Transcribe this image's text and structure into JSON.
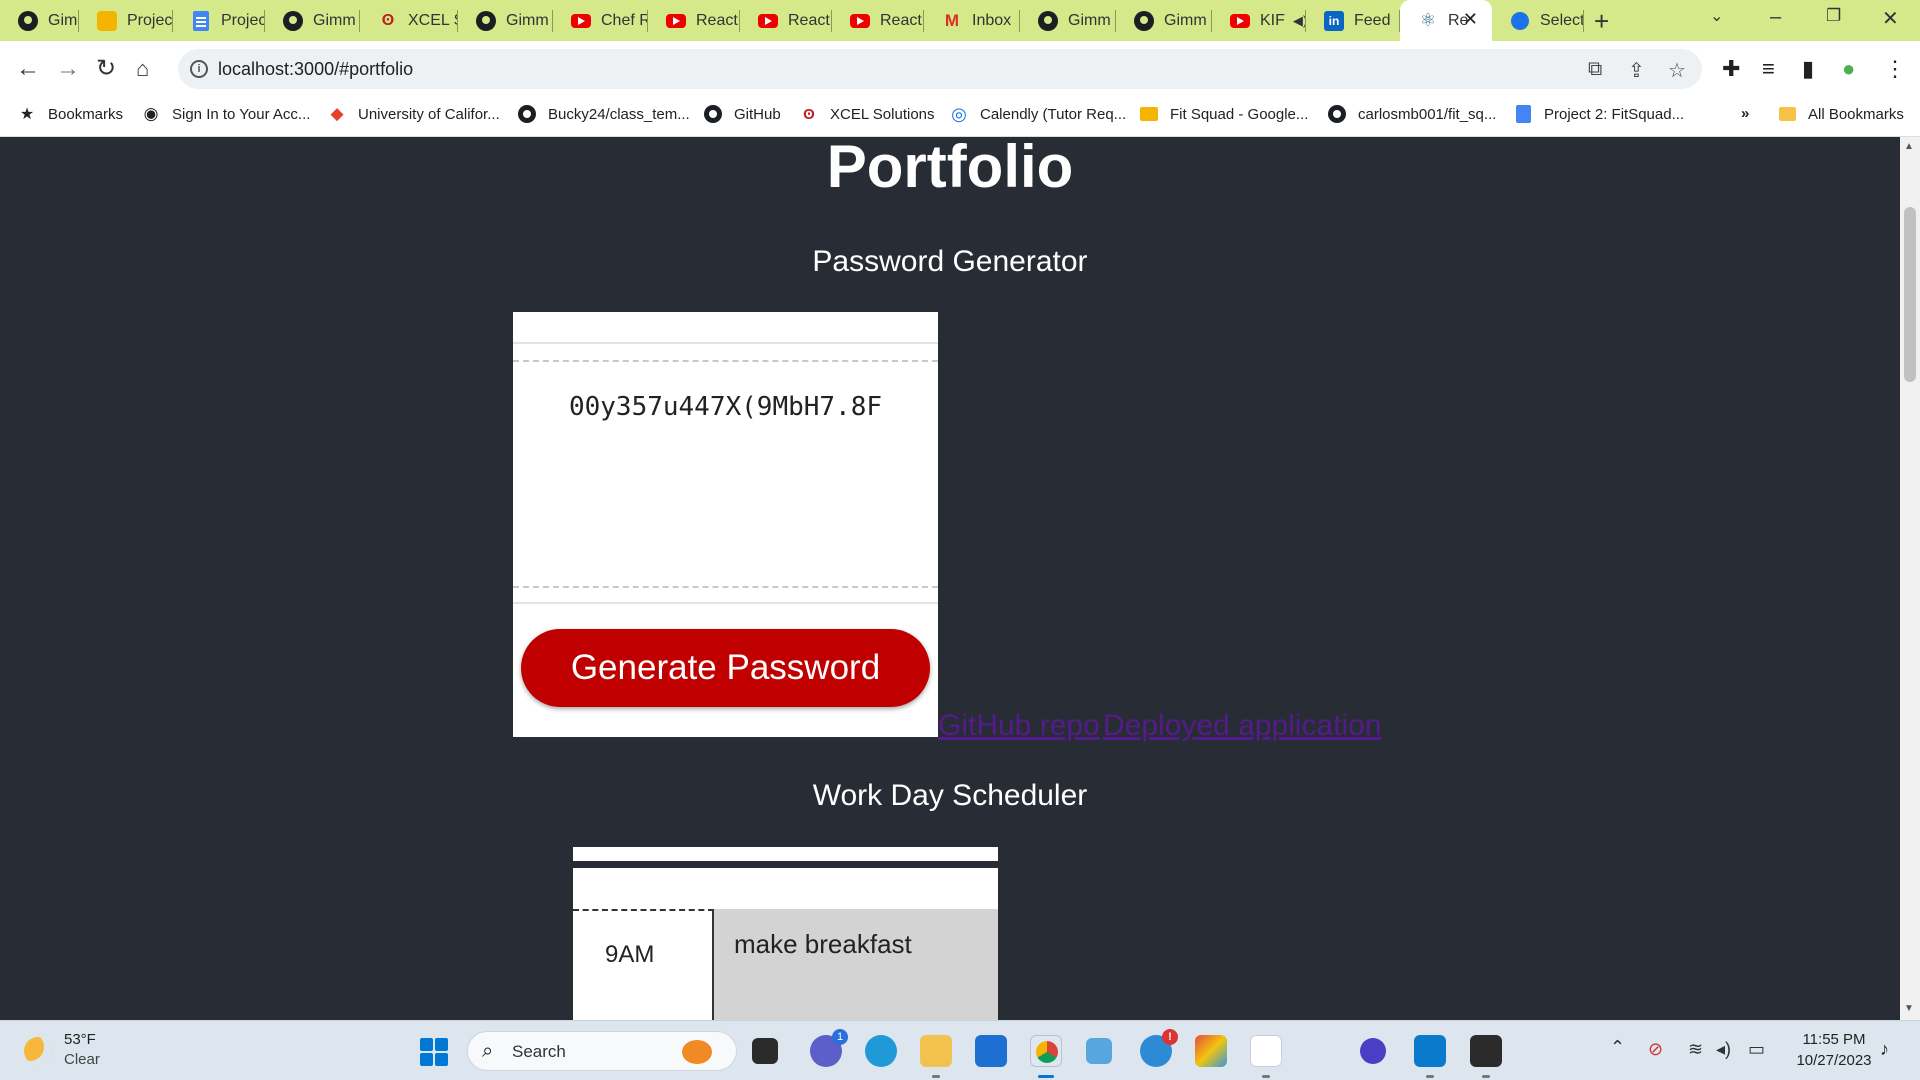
{
  "browser": {
    "tabs": [
      {
        "label": "Gimm",
        "icon": "github-icon"
      },
      {
        "label": "Projec",
        "icon": "project-icon"
      },
      {
        "label": "Projec",
        "icon": "docs-icon"
      },
      {
        "label": "Gimm",
        "icon": "github-icon"
      },
      {
        "label": "XCEL S",
        "icon": "xcel-icon"
      },
      {
        "label": "Gimm",
        "icon": "github-icon"
      },
      {
        "label": "Chef R",
        "icon": "youtube-icon"
      },
      {
        "label": "React",
        "icon": "youtube-icon"
      },
      {
        "label": "React",
        "icon": "youtube-icon"
      },
      {
        "label": "React",
        "icon": "youtube-icon"
      },
      {
        "label": "Inbox",
        "icon": "gmail-icon"
      },
      {
        "label": "Gimm",
        "icon": "github-icon"
      },
      {
        "label": "Gimm",
        "icon": "github-icon"
      },
      {
        "label": "KIF",
        "icon": "youtube-icon"
      },
      {
        "label": "Feed",
        "icon": "linkedin-icon"
      },
      {
        "label": "Re",
        "icon": "react-icon"
      },
      {
        "label": "Select",
        "icon": "select-icon"
      }
    ],
    "url": "localhost:3000/#portfolio",
    "bookmarks": [
      {
        "label": "Bookmarks",
        "icon": "star-icon"
      },
      {
        "label": "Sign In to Your Acc...",
        "icon": "globe-icon"
      },
      {
        "label": "University of Califor...",
        "icon": "gitlab-icon"
      },
      {
        "label": "Bucky24/class_tem...",
        "icon": "github-icon"
      },
      {
        "label": "GitHub",
        "icon": "github-icon"
      },
      {
        "label": "XCEL Solutions",
        "icon": "xcel-icon"
      },
      {
        "label": "Calendly (Tutor Req...",
        "icon": "calendly-icon"
      },
      {
        "label": "Fit Squad - Google...",
        "icon": "slides-icon"
      },
      {
        "label": "carlosmb001/fit_sq...",
        "icon": "github-icon"
      },
      {
        "label": "Project 2: FitSquad...",
        "icon": "docs-icon"
      }
    ],
    "bookmarks_more": "»",
    "all_bookmarks": "All Bookmarks"
  },
  "page": {
    "title": "Portfolio",
    "projects": [
      {
        "title": "Password Generator",
        "password": "00y357u447X(9MbH7.8F",
        "button": "Generate Password",
        "links": [
          "GitHub repo",
          "Deployed application"
        ]
      },
      {
        "title": "Work Day Scheduler",
        "hour": "9AM",
        "task": "make breakfast"
      }
    ]
  },
  "taskbar": {
    "weather_temp": "53°F",
    "weather_cond": "Clear",
    "search_placeholder": "Search",
    "time": "11:55 PM",
    "date": "10/27/2023",
    "teams_badge": "1",
    "alert_badge": "!"
  },
  "colors": {
    "tab_strip": "#d6e98a",
    "page_bg": "#282c34",
    "button_red": "#c00000",
    "link_visited": "#551a8b"
  }
}
